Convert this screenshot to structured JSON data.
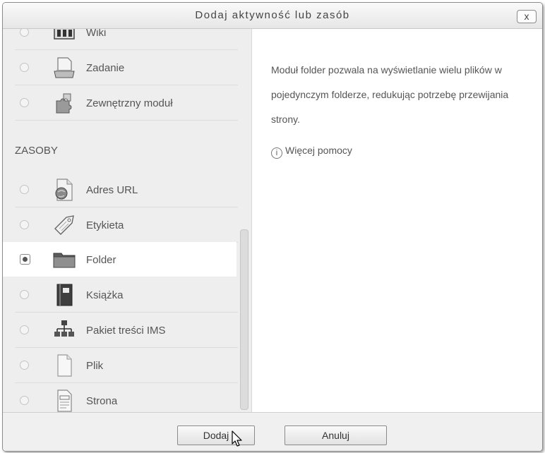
{
  "dialog": {
    "title": "Dodaj aktywność lub zasób",
    "close_label": "x"
  },
  "activities_tail": [
    {
      "label": "Wiki",
      "icon": "wiki-icon"
    },
    {
      "label": "Zadanie",
      "icon": "assignment-icon"
    },
    {
      "label": "Zewnętrzny moduł",
      "icon": "external-tool-icon"
    }
  ],
  "resources": {
    "heading": "ZASOBY",
    "items": [
      {
        "label": "Adres URL",
        "icon": "url-icon"
      },
      {
        "label": "Etykieta",
        "icon": "label-icon"
      },
      {
        "label": "Folder",
        "icon": "folder-icon",
        "selected": true
      },
      {
        "label": "Książka",
        "icon": "book-icon"
      },
      {
        "label": "Pakiet treści IMS",
        "icon": "ims-package-icon"
      },
      {
        "label": "Plik",
        "icon": "file-icon"
      },
      {
        "label": "Strona",
        "icon": "page-icon"
      }
    ]
  },
  "selected": "Folder",
  "description": {
    "text": "Moduł folder pozwala na wyświetlanie wielu plików w pojedynczym folderze, redukując potrzebę przewijania strony.",
    "help_link": "Więcej pomocy",
    "help_icon_glyph": "i"
  },
  "footer": {
    "add_label": "Dodaj",
    "cancel_label": "Anuluj"
  }
}
